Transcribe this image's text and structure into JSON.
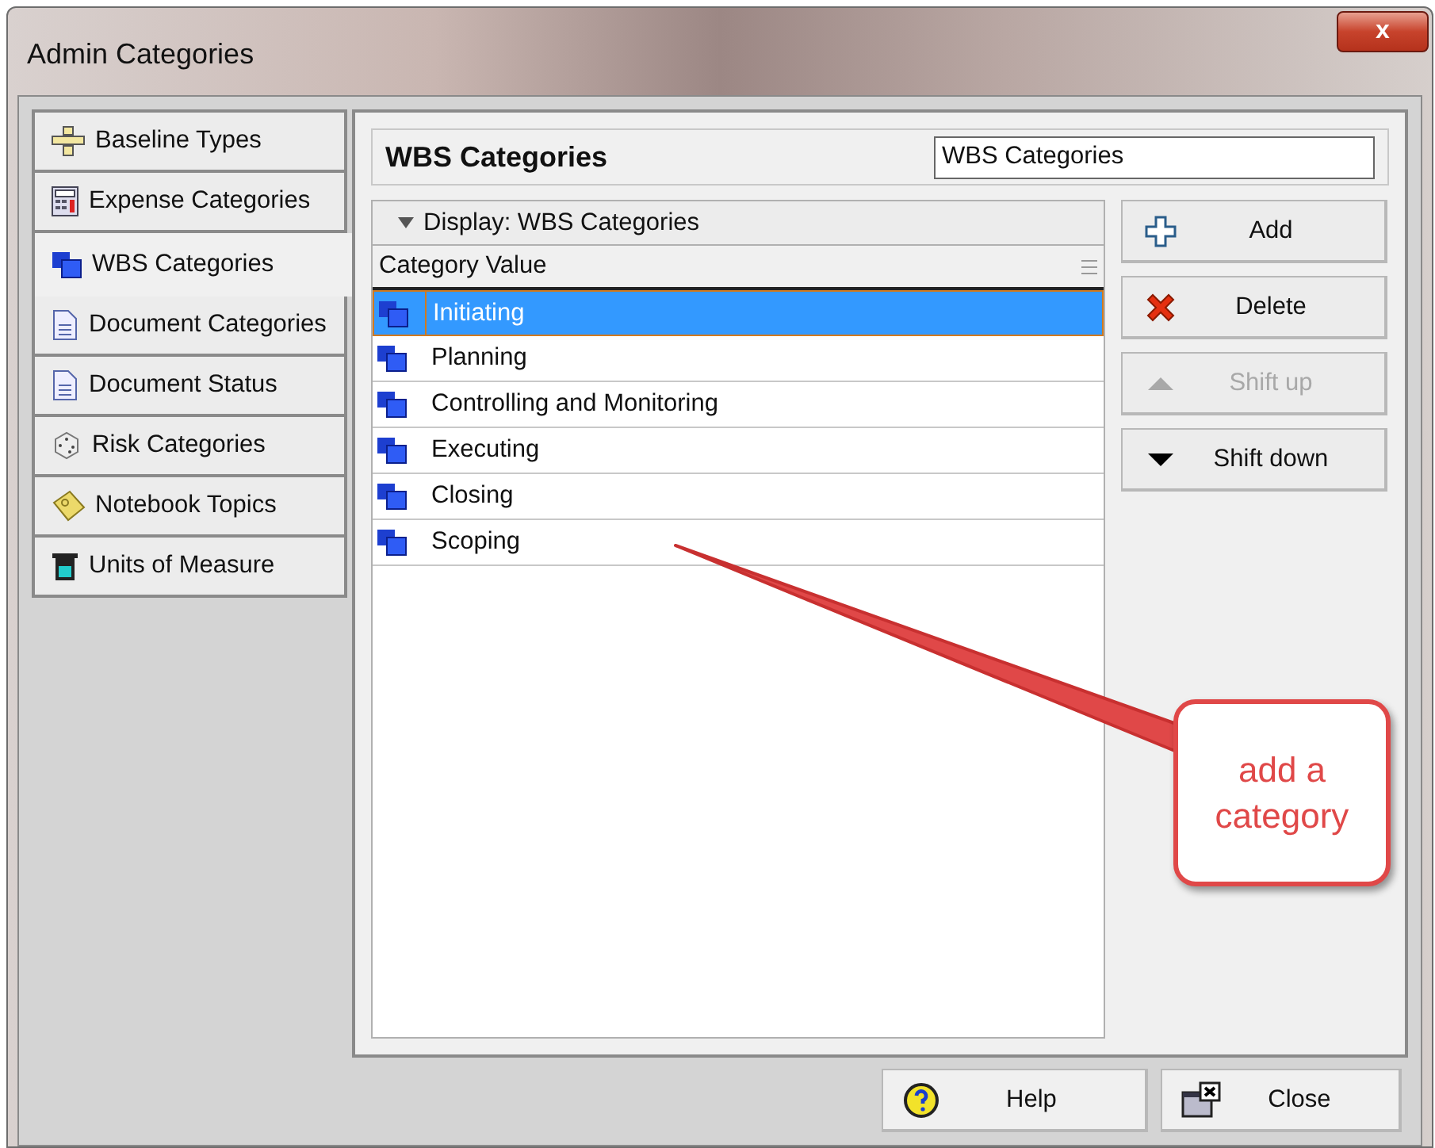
{
  "window": {
    "title": "Admin Categories",
    "close_label": "x"
  },
  "sidebar": {
    "items": [
      {
        "label": "Baseline Types",
        "selected": false
      },
      {
        "label": "Expense Categories",
        "selected": false
      },
      {
        "label": "WBS Categories",
        "selected": true
      },
      {
        "label": "Document Categories",
        "selected": false
      },
      {
        "label": "Document Status",
        "selected": false
      },
      {
        "label": "Risk Categories",
        "selected": false
      },
      {
        "label": "Notebook Topics",
        "selected": false
      },
      {
        "label": "Units of Measure",
        "selected": false
      }
    ]
  },
  "panel": {
    "title": "WBS Categories",
    "name_field": "WBS Categories",
    "display": "Display: WBS Categories",
    "column": "Category Value",
    "rows": [
      {
        "label": "Initiating",
        "selected": true
      },
      {
        "label": "Planning",
        "selected": false
      },
      {
        "label": "Controlling and Monitoring",
        "selected": false
      },
      {
        "label": "Executing",
        "selected": false
      },
      {
        "label": "Closing",
        "selected": false
      },
      {
        "label": "Scoping",
        "selected": false
      }
    ],
    "buttons": [
      {
        "label": "Add",
        "disabled": false
      },
      {
        "label": "Delete",
        "disabled": false
      },
      {
        "label": "Shift up",
        "disabled": true
      },
      {
        "label": "Shift down",
        "disabled": false
      }
    ]
  },
  "footer": {
    "buttons": [
      "Help",
      "Close"
    ]
  },
  "callout": {
    "text": "add a category"
  }
}
